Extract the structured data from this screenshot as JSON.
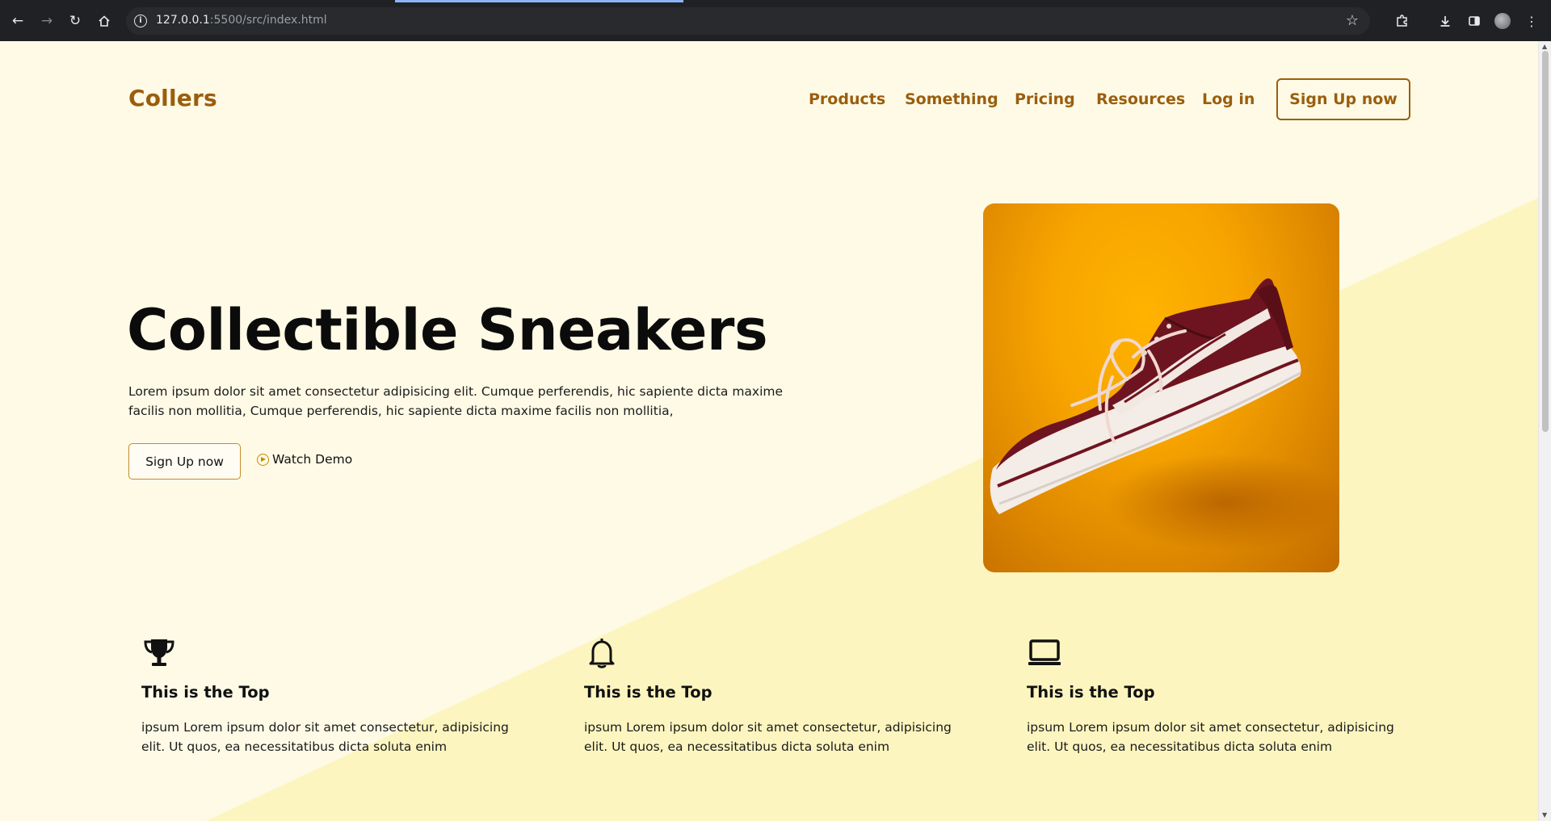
{
  "browser": {
    "url_host": "127.0.0.1",
    "url_path": ":5500/src/index.html"
  },
  "header": {
    "logo": "Collers",
    "nav": [
      "Products",
      "Something",
      "Pricing",
      "Resources",
      "Log in"
    ],
    "cta": "Sign Up now"
  },
  "hero": {
    "title": "Collectible Sneakers",
    "description": "Lorem ipsum dolor sit amet consectetur adipisicing elit. Cumque perferendis, hic sapiente dicta maxime facilis non mollitia, Cumque perferendis, hic sapiente dicta maxime facilis non mollitia,",
    "primary_button": "Sign Up now",
    "secondary_button": "Watch Demo"
  },
  "features": [
    {
      "icon": "trophy-icon",
      "title": "This is the Top",
      "text": "ipsum Lorem ipsum dolor sit amet consectetur, adipisicing elit. Ut quos, ea necessitatibus dicta soluta enim"
    },
    {
      "icon": "bell-icon",
      "title": "This is the Top",
      "text": "ipsum Lorem ipsum dolor sit amet consectetur, adipisicing elit. Ut quos, ea necessitatibus dicta soluta enim"
    },
    {
      "icon": "monitor-icon",
      "title": "This is the Top",
      "text": "ipsum Lorem ipsum dolor sit amet consectetur, adipisicing elit. Ut quos, ea necessitatibus dicta soluta enim"
    }
  ],
  "colors": {
    "brand": "#9a5e0e",
    "page_background": "#fefae6",
    "diagonal_band": "#fdf5bf",
    "card_orange": "#f7a400",
    "shoe_maroon": "#6e1420"
  }
}
